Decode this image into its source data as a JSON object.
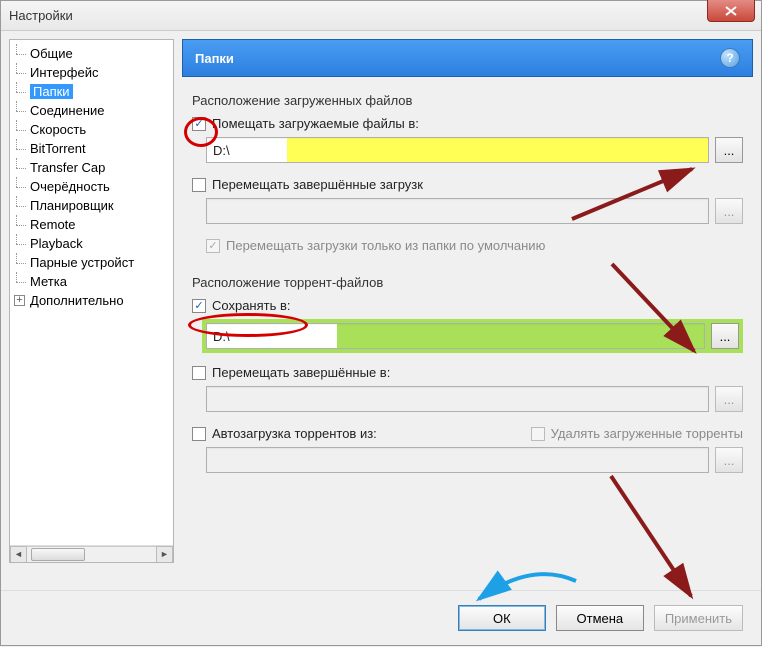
{
  "window": {
    "title": "Настройки"
  },
  "sidebar": {
    "items": [
      "Общие",
      "Интерфейс",
      "Папки",
      "Соединение",
      "Скорость",
      "BitTorrent",
      "Transfer Cap",
      "Очерёдность",
      "Планировщик",
      "Remote",
      "Playback",
      "Парные устройст",
      "Метка"
    ],
    "selected_index": 2,
    "extra": "Дополнительно"
  },
  "panel": {
    "title": "Папки",
    "help": "?"
  },
  "group1": {
    "title": "Расположение загруженных файлов",
    "put_label": "Помещать загружаемые файлы в:",
    "put_checked": true,
    "put_path": "D:\\",
    "move_label": "Перемещать завершённые загрузк",
    "move_checked": false,
    "move_path": "",
    "only_default_label": "Перемещать загрузки только из папки по умолчанию",
    "only_default_checked": true
  },
  "group2": {
    "title": "Расположение торрент-файлов",
    "save_label": "Сохранять в:",
    "save_checked": true,
    "save_path": "D:\\",
    "move_done_label": "Перемещать завершённые в:",
    "move_done_checked": false,
    "move_done_path": "",
    "autoload_label": "Автозагрузка торрентов из:",
    "autoload_checked": false,
    "delete_loaded_label": "Удалять загруженные торренты",
    "delete_loaded_checked": false,
    "autoload_path": ""
  },
  "buttons": {
    "ok": "ОК",
    "cancel": "Отмена",
    "apply": "Применить"
  },
  "browse": "..."
}
